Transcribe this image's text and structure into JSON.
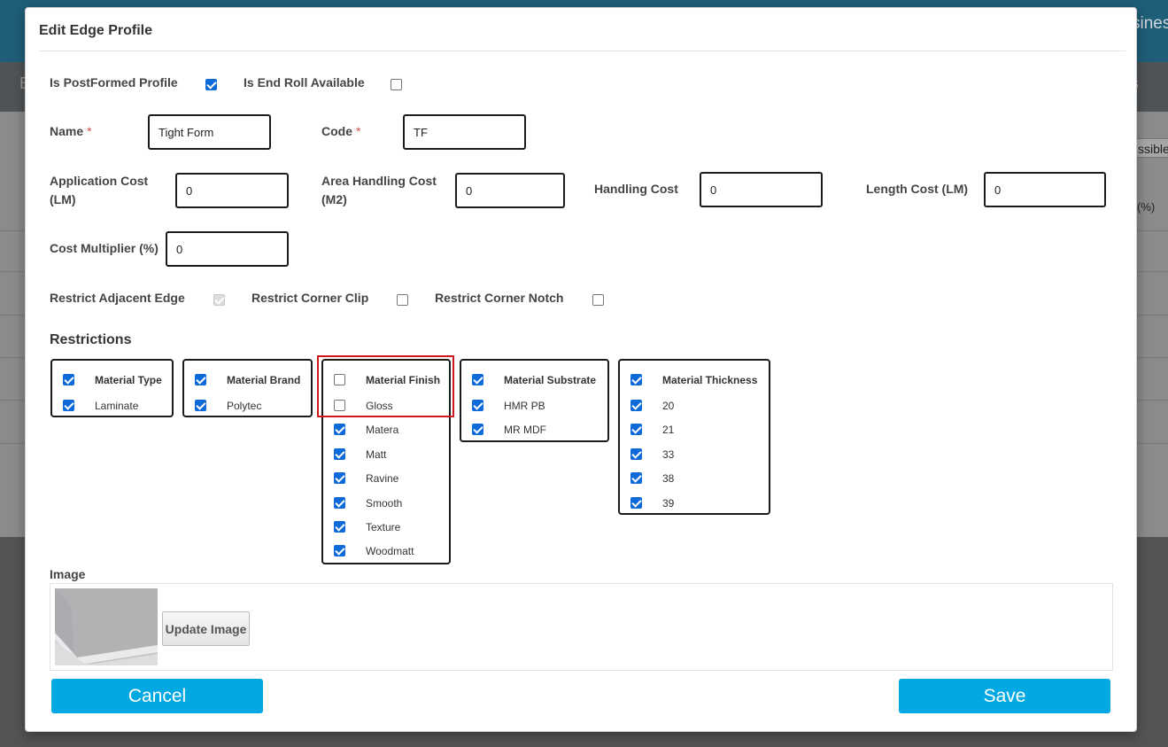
{
  "background": {
    "top_right_text": "sines",
    "button_partial": "ssible",
    "percent_partial": "(%)",
    "nav_left_partial": "E",
    "nav_right_partial": "s"
  },
  "modal": {
    "title": "Edit Edge Profile",
    "flags": {
      "is_postformed_label": "Is PostFormed Profile",
      "is_postformed_checked": true,
      "is_end_roll_label": "Is End Roll Available",
      "is_end_roll_checked": false
    },
    "fields": {
      "name_label": "Name",
      "name_value": "Tight Form",
      "code_label": "Code",
      "code_value": "TF",
      "required_marker": "*",
      "application_cost_label_l1": "Application Cost",
      "application_cost_label_l2": "(LM)",
      "application_cost_value": "0",
      "area_handling_cost_label_l1": "Area Handling Cost",
      "area_handling_cost_label_l2": "(M2)",
      "area_handling_cost_value": "0",
      "handling_cost_label": "Handling Cost",
      "handling_cost_value": "0",
      "length_cost_label": "Length Cost (LM)",
      "length_cost_value": "0",
      "cost_multiplier_label": "Cost Multiplier (%)",
      "cost_multiplier_value": "0"
    },
    "restrict_options": {
      "adjacent_edge_label": "Restrict Adjacent Edge",
      "adjacent_edge_checked": true,
      "adjacent_edge_disabled": true,
      "corner_clip_label": "Restrict Corner Clip",
      "corner_clip_checked": false,
      "corner_notch_label": "Restrict Corner Notch",
      "corner_notch_checked": false
    },
    "restrictions": {
      "title": "Restrictions",
      "groups": [
        {
          "header": "Material Type",
          "header_checked": true,
          "items": [
            {
              "label": "Laminate",
              "checked": true
            }
          ]
        },
        {
          "header": "Material Brand",
          "header_checked": true,
          "items": [
            {
              "label": "Polytec",
              "checked": true
            }
          ]
        },
        {
          "header": "Material Finish",
          "header_checked": false,
          "highlighted": true,
          "items": [
            {
              "label": "Gloss",
              "checked": false
            },
            {
              "label": "Matera",
              "checked": true
            },
            {
              "label": "Matt",
              "checked": true
            },
            {
              "label": "Ravine",
              "checked": true
            },
            {
              "label": "Smooth",
              "checked": true
            },
            {
              "label": "Texture",
              "checked": true
            },
            {
              "label": "Woodmatt",
              "checked": true
            }
          ]
        },
        {
          "header": "Material Substrate",
          "header_checked": true,
          "items": [
            {
              "label": "HMR PB",
              "checked": true
            },
            {
              "label": "MR MDF",
              "checked": true
            }
          ]
        },
        {
          "header": "Material Thickness",
          "header_checked": true,
          "items": [
            {
              "label": "20",
              "checked": true
            },
            {
              "label": "21",
              "checked": true
            },
            {
              "label": "33",
              "checked": true
            },
            {
              "label": "38",
              "checked": true
            },
            {
              "label": "39",
              "checked": true
            }
          ]
        }
      ]
    },
    "image": {
      "label": "Image",
      "update_button": "Update Image"
    },
    "buttons": {
      "cancel": "Cancel",
      "save": "Save"
    },
    "colors": {
      "accent": "#02a8e1",
      "checkbox": "#0d6ad8",
      "highlight": "#d0171b"
    }
  }
}
